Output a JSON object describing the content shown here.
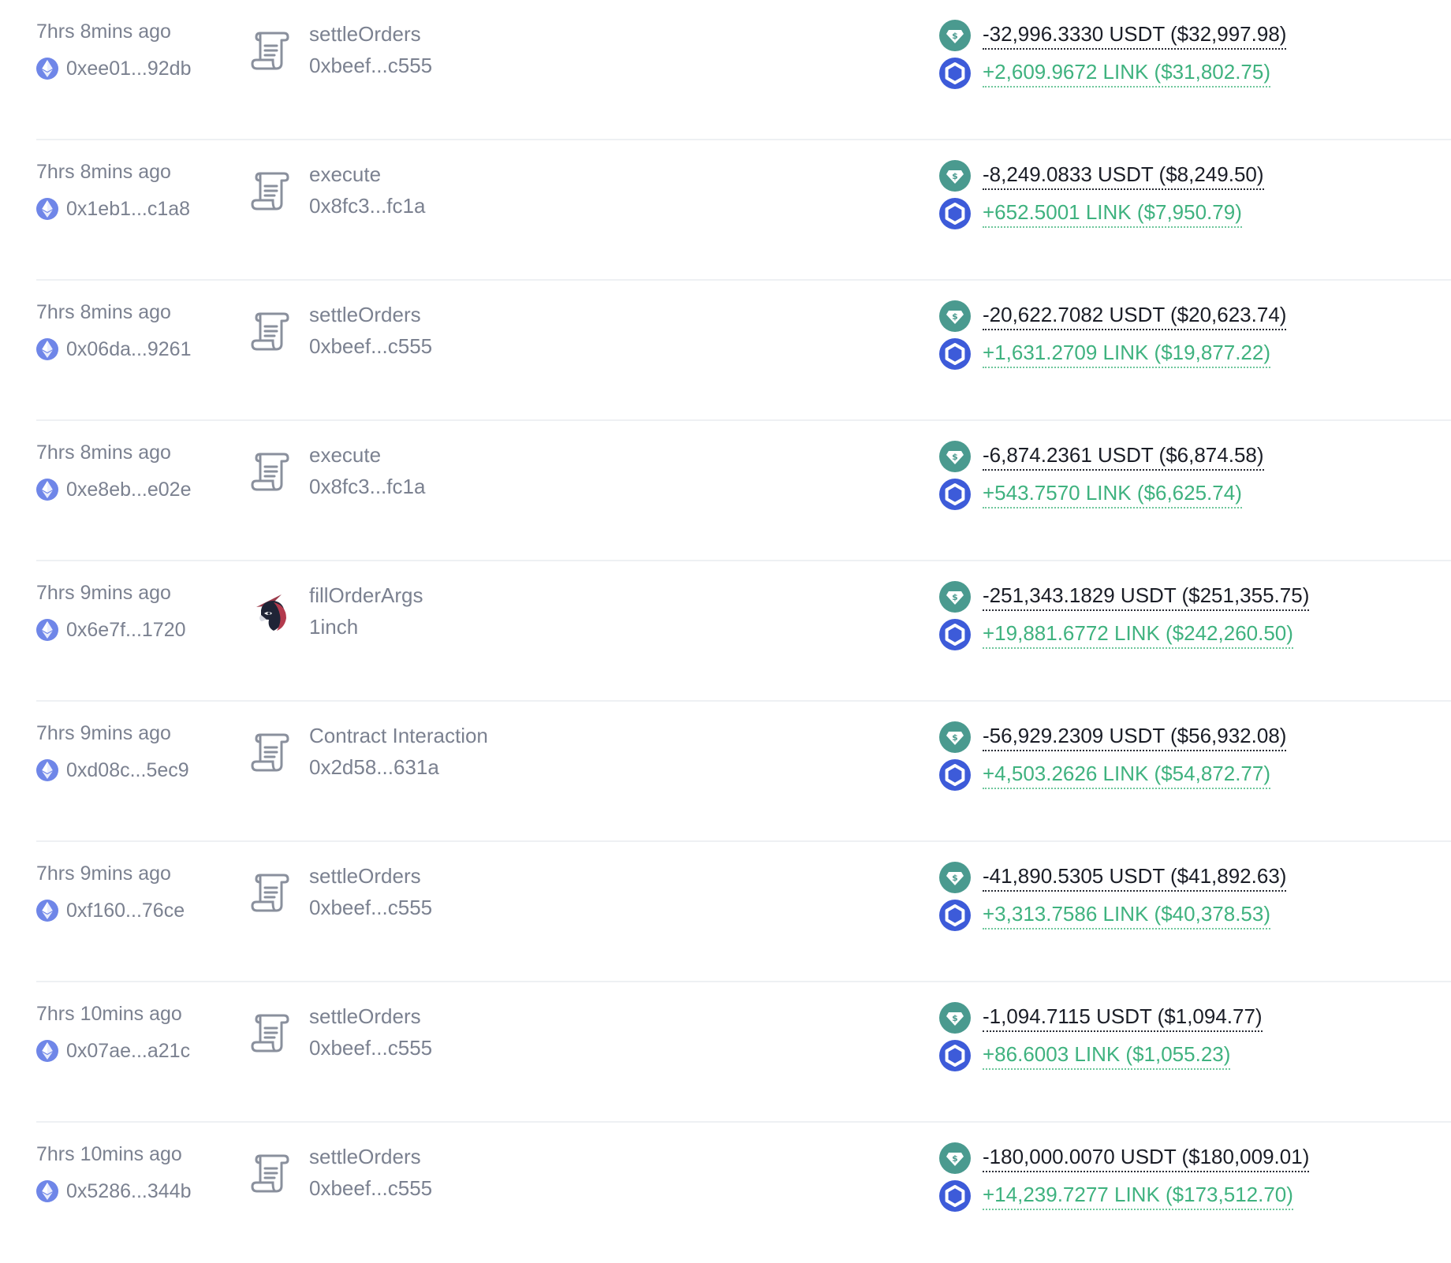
{
  "colors": {
    "text_muted": "#7b8190",
    "negative": "#1a1d26",
    "positive": "#3fb27f",
    "usdt": "#4a9a8f",
    "link": "#3d5bd9",
    "eth": "#6f86e8"
  },
  "icons": {
    "chain": "ethereum-icon",
    "contract": "contract-scroll-icon",
    "oneinch": "1inch-unicorn-icon",
    "token_out": "usdt-token-icon",
    "token_in": "link-token-icon"
  },
  "transactions": [
    {
      "time": "7hrs 8mins ago",
      "address": "0xee01...92db",
      "method": "settleOrders",
      "contract": "0xbeef...c555",
      "contract_icon": "contract-scroll-icon",
      "sent": "-32,996.3330 USDT ($32,997.98)",
      "received": "+2,609.9672 LINK ($31,802.75)"
    },
    {
      "time": "7hrs 8mins ago",
      "address": "0x1eb1...c1a8",
      "method": "execute",
      "contract": "0x8fc3...fc1a",
      "contract_icon": "contract-scroll-icon",
      "sent": "-8,249.0833 USDT ($8,249.50)",
      "received": "+652.5001 LINK ($7,950.79)"
    },
    {
      "time": "7hrs 8mins ago",
      "address": "0x06da...9261",
      "method": "settleOrders",
      "contract": "0xbeef...c555",
      "contract_icon": "contract-scroll-icon",
      "sent": "-20,622.7082 USDT ($20,623.74)",
      "received": "+1,631.2709 LINK ($19,877.22)"
    },
    {
      "time": "7hrs 8mins ago",
      "address": "0xe8eb...e02e",
      "method": "execute",
      "contract": "0x8fc3...fc1a",
      "contract_icon": "contract-scroll-icon",
      "sent": "-6,874.2361 USDT ($6,874.58)",
      "received": "+543.7570 LINK ($6,625.74)"
    },
    {
      "time": "7hrs 9mins ago",
      "address": "0x6e7f...1720",
      "method": "fillOrderArgs",
      "contract": "1inch",
      "contract_icon": "1inch-unicorn-icon",
      "sent": "-251,343.1829 USDT ($251,355.75)",
      "received": "+19,881.6772 LINK ($242,260.50)"
    },
    {
      "time": "7hrs 9mins ago",
      "address": "0xd08c...5ec9",
      "method": "Contract Interaction",
      "contract": "0x2d58...631a",
      "contract_icon": "contract-scroll-icon",
      "sent": "-56,929.2309 USDT ($56,932.08)",
      "received": "+4,503.2626 LINK ($54,872.77)"
    },
    {
      "time": "7hrs 9mins ago",
      "address": "0xf160...76ce",
      "method": "settleOrders",
      "contract": "0xbeef...c555",
      "contract_icon": "contract-scroll-icon",
      "sent": "-41,890.5305 USDT ($41,892.63)",
      "received": "+3,313.7586 LINK ($40,378.53)"
    },
    {
      "time": "7hrs 10mins ago",
      "address": "0x07ae...a21c",
      "method": "settleOrders",
      "contract": "0xbeef...c555",
      "contract_icon": "contract-scroll-icon",
      "sent": "-1,094.7115 USDT ($1,094.77)",
      "received": "+86.6003 LINK ($1,055.23)"
    },
    {
      "time": "7hrs 10mins ago",
      "address": "0x5286...344b",
      "method": "settleOrders",
      "contract": "0xbeef...c555",
      "contract_icon": "contract-scroll-icon",
      "sent": "-180,000.0070 USDT ($180,009.01)",
      "received": "+14,239.7277 LINK ($173,512.70)"
    }
  ]
}
